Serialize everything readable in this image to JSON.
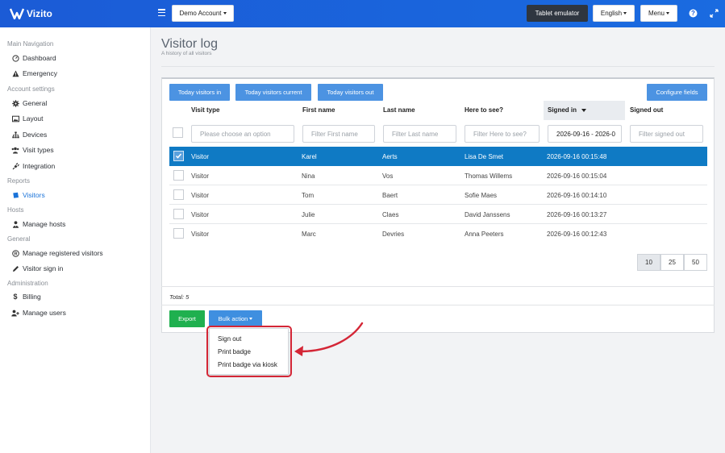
{
  "app": {
    "name": "Vizito",
    "account_label": "Demo Account",
    "tablet_label": "Tablet emulator",
    "language_label": "English",
    "menu_label": "Menu",
    "help_icon": "question-icon",
    "expand_icon": "expand-icon"
  },
  "sidebar": {
    "sections": [
      {
        "heading": "Main Navigation",
        "items": [
          {
            "label": "Dashboard",
            "icon": "dashboard-icon"
          },
          {
            "label": "Emergency",
            "icon": "warning-icon"
          }
        ]
      },
      {
        "heading": "Account settings",
        "items": [
          {
            "label": "General",
            "icon": "gear-icon"
          },
          {
            "label": "Layout",
            "icon": "image-icon"
          },
          {
            "label": "Devices",
            "icon": "sitemap-icon"
          },
          {
            "label": "Visit types",
            "icon": "users-icon"
          },
          {
            "label": "Integration",
            "icon": "plug-icon"
          }
        ]
      },
      {
        "heading": "Reports",
        "items": [
          {
            "label": "Visitors",
            "icon": "book-icon",
            "active": true
          }
        ]
      },
      {
        "heading": "Hosts",
        "items": [
          {
            "label": "Manage hosts",
            "icon": "user-tie-icon"
          }
        ]
      },
      {
        "heading": "General",
        "items": [
          {
            "label": "Manage registered visitors",
            "icon": "registered-icon"
          },
          {
            "label": "Visitor sign in",
            "icon": "pencil-icon"
          }
        ]
      },
      {
        "heading": "Administration",
        "items": [
          {
            "label": "Billing",
            "icon": "dollar-icon"
          },
          {
            "label": "Manage users",
            "icon": "user-plus-icon"
          }
        ]
      }
    ]
  },
  "page": {
    "title": "Visitor log",
    "subtitle": "A history of all visitors"
  },
  "filters": {
    "today_in": "Today visitors in",
    "today_current": "Today visitors current",
    "today_out": "Today visitors out",
    "configure": "Configure fields"
  },
  "table": {
    "columns": [
      "Visit type",
      "First name",
      "Last name",
      "Here to see?",
      "Signed in",
      "Signed out"
    ],
    "filter_placeholders": {
      "visit_type": "Please choose an option",
      "first_name": "Filter First name",
      "last_name": "Filter Last name",
      "here_to_see": "Filter Here to see?",
      "signed_in_value": "2026-09-16 - 2026-0",
      "signed_out": "Filter signed out"
    },
    "rows": [
      {
        "visit_type": "Visitor",
        "first_name": "Karel",
        "last_name": "Aerts",
        "here_to_see": "Lisa De Smet",
        "signed_in": "2026-09-16 00:15:48",
        "signed_out": "",
        "selected": true
      },
      {
        "visit_type": "Visitor",
        "first_name": "Nina",
        "last_name": "Vos",
        "here_to_see": "Thomas Willems",
        "signed_in": "2026-09-16 00:15:04",
        "signed_out": ""
      },
      {
        "visit_type": "Visitor",
        "first_name": "Tom",
        "last_name": "Baert",
        "here_to_see": "Sofie Maes",
        "signed_in": "2026-09-16 00:14:10",
        "signed_out": ""
      },
      {
        "visit_type": "Visitor",
        "first_name": "Julie",
        "last_name": "Claes",
        "here_to_see": "David Janssens",
        "signed_in": "2026-09-16 00:13:27",
        "signed_out": ""
      },
      {
        "visit_type": "Visitor",
        "first_name": "Marc",
        "last_name": "Devries",
        "here_to_see": "Anna Peeters",
        "signed_in": "2026-09-16 00:12:43",
        "signed_out": ""
      }
    ],
    "page_sizes": [
      "10",
      "25",
      "50"
    ],
    "active_page_size": "10",
    "total": "Total: 5"
  },
  "actions": {
    "export": "Export",
    "bulk": "Bulk action",
    "bulk_menu": [
      "Sign out",
      "Print badge",
      "Print badge via kiosk"
    ]
  },
  "colors": {
    "topbar": "#1b5bd6",
    "accent": "#4c93e2",
    "selected_row": "#0f7ac4",
    "export": "#1fb04f",
    "highlight": "#d42636"
  }
}
